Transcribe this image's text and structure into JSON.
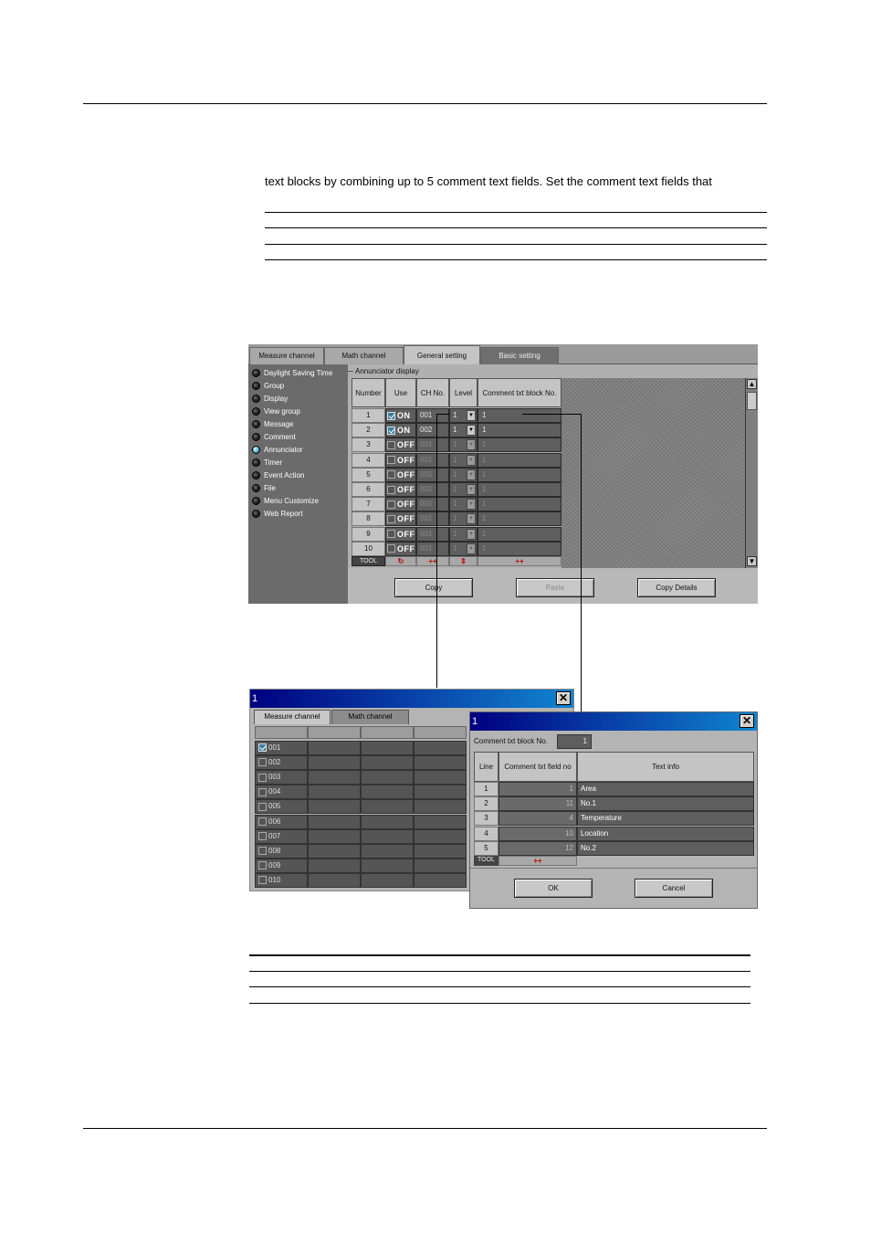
{
  "page": {
    "body_text": "text blocks by combining up to 5 comment text fields. Set the comment text fields that"
  },
  "main_window": {
    "tabs": [
      "Measure channel",
      "Math channel",
      "General setting",
      "Basic setting"
    ],
    "active_tab": "General setting",
    "sidebar": [
      {
        "label": "Daylight Saving Time",
        "selected": false
      },
      {
        "label": "Group",
        "selected": false
      },
      {
        "label": "Display",
        "selected": false
      },
      {
        "label": "View group",
        "selected": false
      },
      {
        "label": "Message",
        "selected": false
      },
      {
        "label": "Comment",
        "selected": false
      },
      {
        "label": "Annunciator",
        "selected": true
      },
      {
        "label": "Timer",
        "selected": false
      },
      {
        "label": "Event Action",
        "selected": false
      },
      {
        "label": "File",
        "selected": false
      },
      {
        "label": "Menu Customize",
        "selected": false
      },
      {
        "label": "Web Report",
        "selected": false
      }
    ],
    "group_label": "Annunciator display",
    "columns": [
      "Number",
      "Use",
      "CH No.",
      "Level",
      "Comment txt block No."
    ],
    "rows": [
      {
        "number": "1",
        "use": "ON",
        "ch": "001",
        "level": "1",
        "comment": "1",
        "enabled": true
      },
      {
        "number": "2",
        "use": "ON",
        "ch": "002",
        "level": "1",
        "comment": "1",
        "enabled": true
      },
      {
        "number": "3",
        "use": "OFF",
        "ch": "001",
        "level": "1",
        "comment": "1",
        "enabled": false
      },
      {
        "number": "4",
        "use": "OFF",
        "ch": "001",
        "level": "1",
        "comment": "1",
        "enabled": false
      },
      {
        "number": "5",
        "use": "OFF",
        "ch": "001",
        "level": "1",
        "comment": "1",
        "enabled": false
      },
      {
        "number": "6",
        "use": "OFF",
        "ch": "001",
        "level": "1",
        "comment": "1",
        "enabled": false
      },
      {
        "number": "7",
        "use": "OFF",
        "ch": "001",
        "level": "1",
        "comment": "1",
        "enabled": false
      },
      {
        "number": "8",
        "use": "OFF",
        "ch": "001",
        "level": "1",
        "comment": "1",
        "enabled": false
      },
      {
        "number": "9",
        "use": "OFF",
        "ch": "001",
        "level": "1",
        "comment": "1",
        "enabled": false
      },
      {
        "number": "10",
        "use": "OFF",
        "ch": "001",
        "level": "1",
        "comment": "1",
        "enabled": false
      }
    ],
    "tool_label": "TOOL",
    "tool_icons": [
      "↻",
      "++",
      "⇕",
      "++"
    ],
    "buttons": {
      "copy": "Copy",
      "paste": "Paste",
      "copy_details": "Copy Details"
    },
    "scroll_up": "▲",
    "scroll_down": "▼"
  },
  "channel_dialog": {
    "title": "1",
    "close": "✕",
    "tabs": [
      "Measure channel",
      "Math channel"
    ],
    "channels": [
      {
        "label": "001",
        "checked": true
      },
      {
        "label": "002",
        "checked": false
      },
      {
        "label": "003",
        "checked": false
      },
      {
        "label": "004",
        "checked": false
      },
      {
        "label": "005",
        "checked": false
      },
      {
        "label": "006",
        "checked": false
      },
      {
        "label": "007",
        "checked": false
      },
      {
        "label": "008",
        "checked": false
      },
      {
        "label": "009",
        "checked": false
      },
      {
        "label": "010",
        "checked": false
      }
    ]
  },
  "comment_dialog": {
    "title": "1",
    "close": "✕",
    "block_label": "Comment txt block No.",
    "block_value": "1",
    "columns": [
      "Line",
      "Comment txt field no",
      "Text info"
    ],
    "rows": [
      {
        "line": "1",
        "field": "1",
        "text": "Area"
      },
      {
        "line": "2",
        "field": "11",
        "text": "No.1"
      },
      {
        "line": "3",
        "field": "4",
        "text": "Temperature"
      },
      {
        "line": "4",
        "field": "10",
        "text": "Location"
      },
      {
        "line": "5",
        "field": "12",
        "text": "No.2"
      }
    ],
    "tool_label": "TOOL",
    "tool_icon": "++",
    "ok": "OK",
    "cancel": "Cancel"
  }
}
